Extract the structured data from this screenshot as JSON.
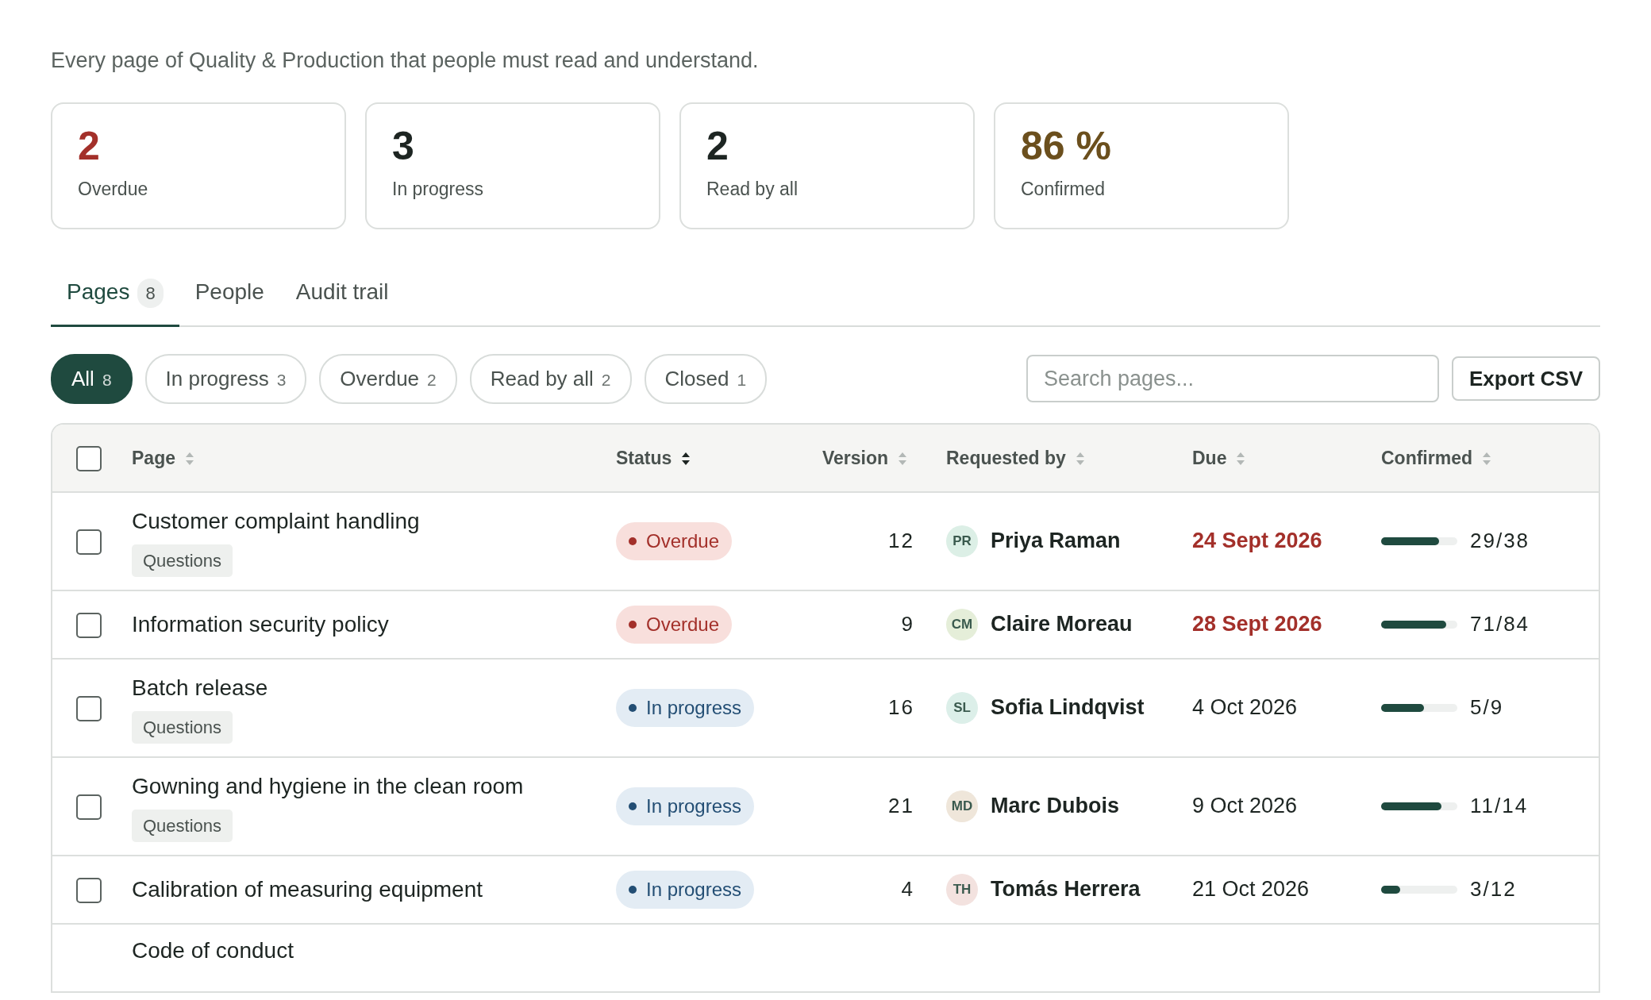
{
  "description": "Every page of Quality & Production that people must read and understand.",
  "stats": [
    {
      "value": "2",
      "label": "Overdue",
      "kind": "overdue"
    },
    {
      "value": "3",
      "label": "In progress",
      "kind": "plain"
    },
    {
      "value": "2",
      "label": "Read by all",
      "kind": "plain"
    },
    {
      "value": "86 %",
      "label": "Confirmed",
      "kind": "score"
    }
  ],
  "tabs": [
    {
      "label": "Pages",
      "count": "8",
      "selected": true
    },
    {
      "label": "People",
      "selected": false
    },
    {
      "label": "Audit trail",
      "selected": false
    }
  ],
  "filters": [
    {
      "label": "All",
      "count": "8",
      "selected": true
    },
    {
      "label": "In progress",
      "count": "3",
      "selected": false
    },
    {
      "label": "Overdue",
      "count": "2",
      "selected": false
    },
    {
      "label": "Read by all",
      "count": "2",
      "selected": false
    },
    {
      "label": "Closed",
      "count": "1",
      "selected": false
    }
  ],
  "search": {
    "placeholder": "Search pages..."
  },
  "export_button": "Export CSV",
  "table": {
    "select_all": {
      "checked": false
    },
    "columns": [
      {
        "label": "Page",
        "sorted": false
      },
      {
        "label": "Status",
        "sorted": true
      },
      {
        "label": "Version",
        "sorted": false
      },
      {
        "label": "Requested by",
        "sorted": false
      },
      {
        "label": "Due",
        "sorted": false
      },
      {
        "label": "Confirmed",
        "sorted": false
      }
    ],
    "rows": [
      {
        "checked": false,
        "title": "Customer complaint handling",
        "tag": "Questions",
        "status": {
          "kind": "overdue",
          "label": "Overdue"
        },
        "version": "12",
        "initials": "PR",
        "color": "#dcefe6",
        "requester": "Priya Raman",
        "due": "24 Sept 2026",
        "overdue": true,
        "level": 0.76,
        "confirmed": "29/38"
      },
      {
        "checked": false,
        "title": "Information security policy",
        "status": {
          "kind": "overdue",
          "label": "Overdue"
        },
        "version": "9",
        "initials": "CM",
        "color": "#e5eed9",
        "requester": "Claire Moreau",
        "due": "28 Sept 2026",
        "overdue": true,
        "level": 0.85,
        "confirmed": "71/84"
      },
      {
        "checked": false,
        "title": "Batch release",
        "tag": "Questions",
        "status": {
          "kind": "progress",
          "label": "In progress"
        },
        "version": "16",
        "initials": "SL",
        "color": "#dcefe9",
        "requester": "Sofia Lindqvist",
        "due": "4 Oct 2026",
        "overdue": false,
        "level": 0.56,
        "confirmed": "5/9"
      },
      {
        "checked": false,
        "title": "Gowning and hygiene in the clean room",
        "tag": "Questions",
        "status": {
          "kind": "progress",
          "label": "In progress"
        },
        "version": "21",
        "initials": "MD",
        "color": "#efe6da",
        "requester": "Marc Dubois",
        "due": "9 Oct 2026",
        "overdue": false,
        "level": 0.79,
        "confirmed": "11/14"
      },
      {
        "checked": false,
        "title": "Calibration of measuring equipment",
        "status": {
          "kind": "progress",
          "label": "In progress"
        },
        "version": "4",
        "initials": "TH",
        "color": "#f3e2df",
        "requester": "Tomás Herrera",
        "due": "21 Oct 2026",
        "overdue": false,
        "level": 0.25,
        "confirmed": "3/12"
      },
      {
        "title": "Code of conduct"
      }
    ]
  }
}
